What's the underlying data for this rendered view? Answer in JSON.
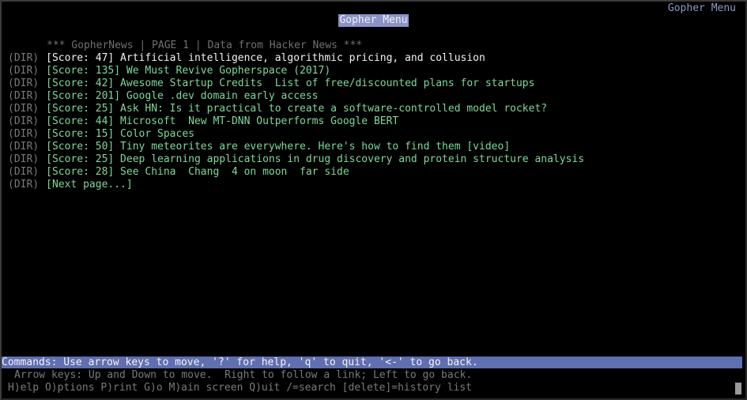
{
  "window": {
    "corner_title": "Gopher Menu"
  },
  "page": {
    "title": "Gopher Menu",
    "header": "*** GopherNews | PAGE 1 | Data from Hacker News ***"
  },
  "links": [
    {
      "type": "(DIR)",
      "text": "[Score: 47] Artificial intelligence, algorithmic pricing, and collusion",
      "selected": true
    },
    {
      "type": "(DIR)",
      "text": "[Score: 135] We Must Revive Gopherspace (2017)"
    },
    {
      "type": "(DIR)",
      "text": "[Score: 42] Awesome Startup Credits  List of free/discounted plans for startups"
    },
    {
      "type": "(DIR)",
      "text": "[Score: 201] Google .dev domain early access"
    },
    {
      "type": "(DIR)",
      "text": "[Score: 25] Ask HN: Is it practical to create a software-controlled model rocket?"
    },
    {
      "type": "(DIR)",
      "text": "[Score: 44] Microsoft  New MT-DNN Outperforms Google BERT"
    },
    {
      "type": "(DIR)",
      "text": "[Score: 15] Color Spaces"
    },
    {
      "type": "(DIR)",
      "text": "[Score: 50] Tiny meteorites are everywhere. Here's how to find them [video]"
    },
    {
      "type": "(DIR)",
      "text": "[Score: 25] Deep learning applications in drug discovery and protein structure analysis"
    },
    {
      "type": "(DIR)",
      "text": "[Score: 28] See China  Chang  4 on moon  far side"
    },
    {
      "type": "(DIR)",
      "text": "[Next page...]"
    }
  ],
  "status": {
    "commands": "Commands: Use arrow keys to move, '?' for help, 'q' to quit, '<-' to go back."
  },
  "help": {
    "line1": "Arrow keys: Up and Down to move.  Right to follow a link; Left to go back.",
    "line2": "H)elp O)ptions P)rint G)o M)ain screen Q)uit /=search [delete]=history list"
  },
  "colors": {
    "link": "#7ed89a",
    "selected_link": "#f2f2f2",
    "status_bar": "#5f6fb0",
    "title_highlight": "#8b93c8",
    "corner_title": "#8d99c6"
  }
}
